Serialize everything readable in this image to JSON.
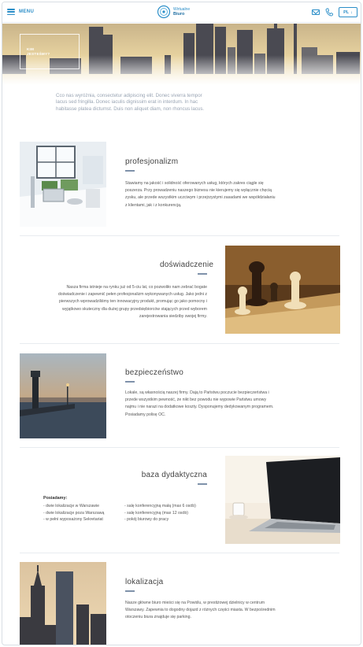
{
  "header": {
    "menu_label": "MENU",
    "logo_line1": "Wirtualne",
    "logo_line2": "Biuro",
    "lang_label": "PL",
    "lang_arrow": "↓"
  },
  "hero": {
    "label": "KIM JESTEŚMY?"
  },
  "intro": "Cco nas wyróżnia, consectetur adipiscing elit. Donec viverra tempor lacus sed fringilla. Donec iaculis dignissim erat in interdum. In hac habitasse platea dictumst. Duis non aliquet diam, non rhoncus lacus.",
  "sections": [
    {
      "title": "profesjonalizm",
      "text": "Stawiamy na jakość i solidność oferowanych usług, których zakres ciągle się poszerza. Przy prowadzeniu naszego biznesu nie kierujemy się wyłącznie chęcią zysku, ale przede wszystkim uczciwym i przejrzystymi zasadami we współdziałaniu z klientami, jak i z konkurencją."
    },
    {
      "title": "doświadczenie",
      "text": "Nasza firma istnieje na rynku już od 5-ciu lat, co pozwoliło nam zebrać bogate doświadczenie i zapewnić pełen profesjonalizm wykonywanych usług. Jako jedni z pierwszych wprowadziliśmy ten innowacyjny produkt, promując go jako pomocny i wyjątkowo skuteczny dla dużej grupy przedsiębiorców stających przed wyborem zarejestrowania siedziby swojej firmy."
    },
    {
      "title": "bezpieczeństwo",
      "text": "Lokale, są własnością naszej firmy. Dają  to Państwu poczucie bezpieczeństwa i przede wszystkim pewność, że nikt bez powodu nie wypowie Państwu umowy najmu i nie narazi  na dodatkowe koszty. Dysponujemy dedykowanym programem. Posiadamy polisę OC."
    },
    {
      "title": "baza dydaktyczna",
      "list_title": "Posiadamy:",
      "list_left": [
        "- dwie lokalizacje w Warszawie",
        "- dwie lokalizacje poza Warszawą",
        "- w pełni wyposażony Sekretariat"
      ],
      "list_right": [
        "- salę konferencyjną małą  (max 6 osób)",
        "- salę  konferencyjną  (max 12 osób)",
        "- pokój biurowy do pracy"
      ]
    },
    {
      "title": "lokalizacja",
      "text": "Nasze główne biuro mieści się na Powiślu, w prestiżowej dzielnicy w centrum Warszawy. Zapewnia to dogodny dojazd z różnych części miasta. W bezpośrednim otoczeniu biura znajduje się parking."
    }
  ],
  "colors": {
    "accent": "#2b8ec8",
    "dash": "#7f92aa",
    "text": "#555555"
  }
}
